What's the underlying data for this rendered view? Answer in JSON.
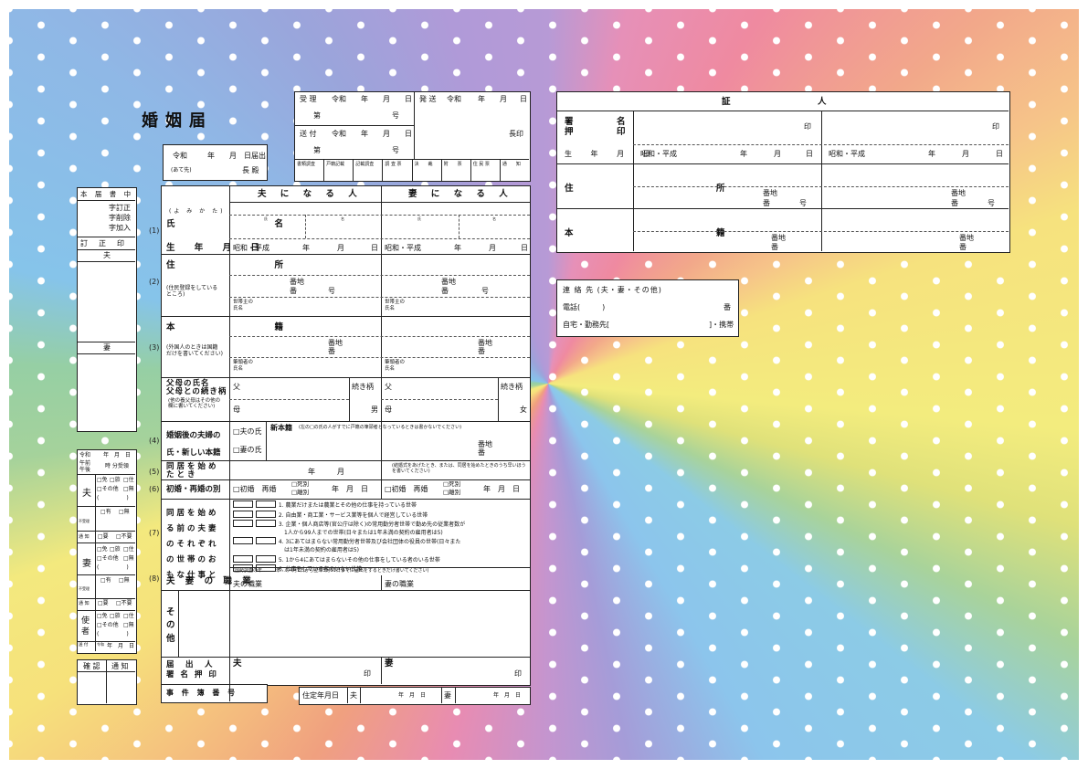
{
  "title": "婚姻届",
  "submit": {
    "era": "令和",
    "year": "年",
    "month": "月",
    "day": "日届出",
    "to": "(あて先)",
    "chief": "長 殿"
  },
  "office": {
    "received": "受 理",
    "era": "令和",
    "y": "年",
    "m": "月",
    "d": "日",
    "no": "第",
    "go": "号",
    "sent": "送 付",
    "dispatch": "発 送",
    "seal": "長印",
    "checks": [
      "書類調査",
      "戸籍記載",
      "記載調査",
      "調 査 票",
      "決　　裁",
      "附　　票",
      "住 民 票",
      "通　　知"
    ]
  },
  "side": {
    "header": "本 届 書 中",
    "corrections": [
      "字訂正",
      "字削除",
      "字加入"
    ],
    "seal": "訂　正　印",
    "husband": "夫",
    "wife": "妻"
  },
  "reception": {
    "era": "令和",
    "date": "年　月　日",
    "ampm": "午前\n午後",
    "time": "時 分受領",
    "husband": "夫",
    "wife": "妻",
    "messenger": "使者",
    "opts1": [
      "□免",
      "□旅",
      "□住"
    ],
    "opts2": [
      "□その他",
      "□無"
    ],
    "paren": "(　　　　　)",
    "absent": "不受理",
    "absent_opts": [
      "□有",
      "□無"
    ],
    "notify": "通 知",
    "notify_opts": [
      "□要",
      "□不要"
    ],
    "sent": "送 付",
    "sent_era": "令和",
    "sent_date": "年　月　日",
    "confirm": "確 認",
    "notice": "通 知"
  },
  "form": {
    "head_h": "夫 に な る 人",
    "head_w": "妻 に な る 人",
    "reading": "(よ み か た)",
    "name": "氏　　名",
    "surname": "氏",
    "given": "名",
    "birth": "生 年 月 日",
    "era": "昭和・平成",
    "y": "年",
    "m": "月",
    "d": "日",
    "address": "住　　所",
    "address_note": "(住民登録をしているところ)",
    "banchi": "番地",
    "ban": "番",
    "go": "号",
    "householder": "世帯主の氏名",
    "honseki": "本　　籍",
    "honseki_note": "(外国人のときは国籍だけを書いてください)",
    "head_person": "筆頭者の氏名",
    "parents": "父母の氏名\n父母との続き柄",
    "parents_note": "(他の養父母はその他の欄に書いてください)",
    "father": "父",
    "mother": "母",
    "relation": "続き柄",
    "male": "男",
    "female": "女",
    "after": "婚姻後の夫婦の\n氏・新しい本籍",
    "opt_h": "□夫の氏",
    "opt_w": "□妻の氏",
    "new_honseki": "新本籍",
    "new_note": "(左の□の氏の人がすでに戸籍の筆頭者となっているときは書かないでください)",
    "cohab": "同居を始めたとき",
    "cohab_ym": "年　　　月",
    "cohab_note": "(結婚式をあげたとき、または、同居を始めたときのうち早いほうを書いてください)",
    "first": "初婚・再婚の別",
    "first_opt": "□初婚　再婚",
    "death": "□死別",
    "divorce": "□離別",
    "ymd": "年　月　日",
    "work_label": "同居を始める前の夫妻のそれぞれの世帯のおもな仕事と",
    "jobs": [
      "1. 農業だけまたは農業とその他の仕事を持っている世帯",
      "2. 自由業・商工業・サービス業等を個人で経営している世帯",
      "3. 企業・個人商店等(官公庁は除く)の常用勤労者世帯で勤め先の従業者数が",
      "　1人から99人までの世帯(日々または1年未満の契約の雇用者は5)",
      "4. 3にあてはまらない常用勤労者世帯及び会社団体の役員の世帯(日々また",
      "　は1年未満の契約の雇用者は5)",
      "5. 1から4にあてはまらないその他の仕事をしている者のいる世帯",
      "6. 仕事をしている者のいない世帯"
    ],
    "occupation": "夫 妻 の 職 業",
    "census": "(国勢調査の年…　　年…の4月1日から翌年3月31日までに届出をするときだけ書いてください)",
    "occ_h": "夫の職業",
    "occ_w": "妻の職業",
    "other": "そ\nの\n他",
    "signer": "届　出　人\n署 名 押 印",
    "husband": "夫",
    "wife": "妻",
    "seal": "印",
    "case_no": "事 件 簿 番 号",
    "residence_date": "住定年月日",
    "numbers": [
      "(1)",
      "(2)",
      "(3)",
      "(4)",
      "(5)",
      "(6)",
      "(7)",
      "(8)"
    ]
  },
  "witness": {
    "title": "証　　　　　人",
    "signature": "署\n押",
    "sig2": "名\n印",
    "seal": "印",
    "birth": "生 年 月 日",
    "era": "昭和・平成",
    "y": "年",
    "m": "月",
    "d": "日",
    "address": "住　　　所",
    "banchi": "番地",
    "ban": "番",
    "go": "号",
    "honseki": "本　　　籍"
  },
  "contact": {
    "title": "連 絡 先 (夫・妻・その他)",
    "phone": "電話(　　　)",
    "ban": "番",
    "home": "自宅・勤務先[",
    "mobile": "]・携帯"
  }
}
